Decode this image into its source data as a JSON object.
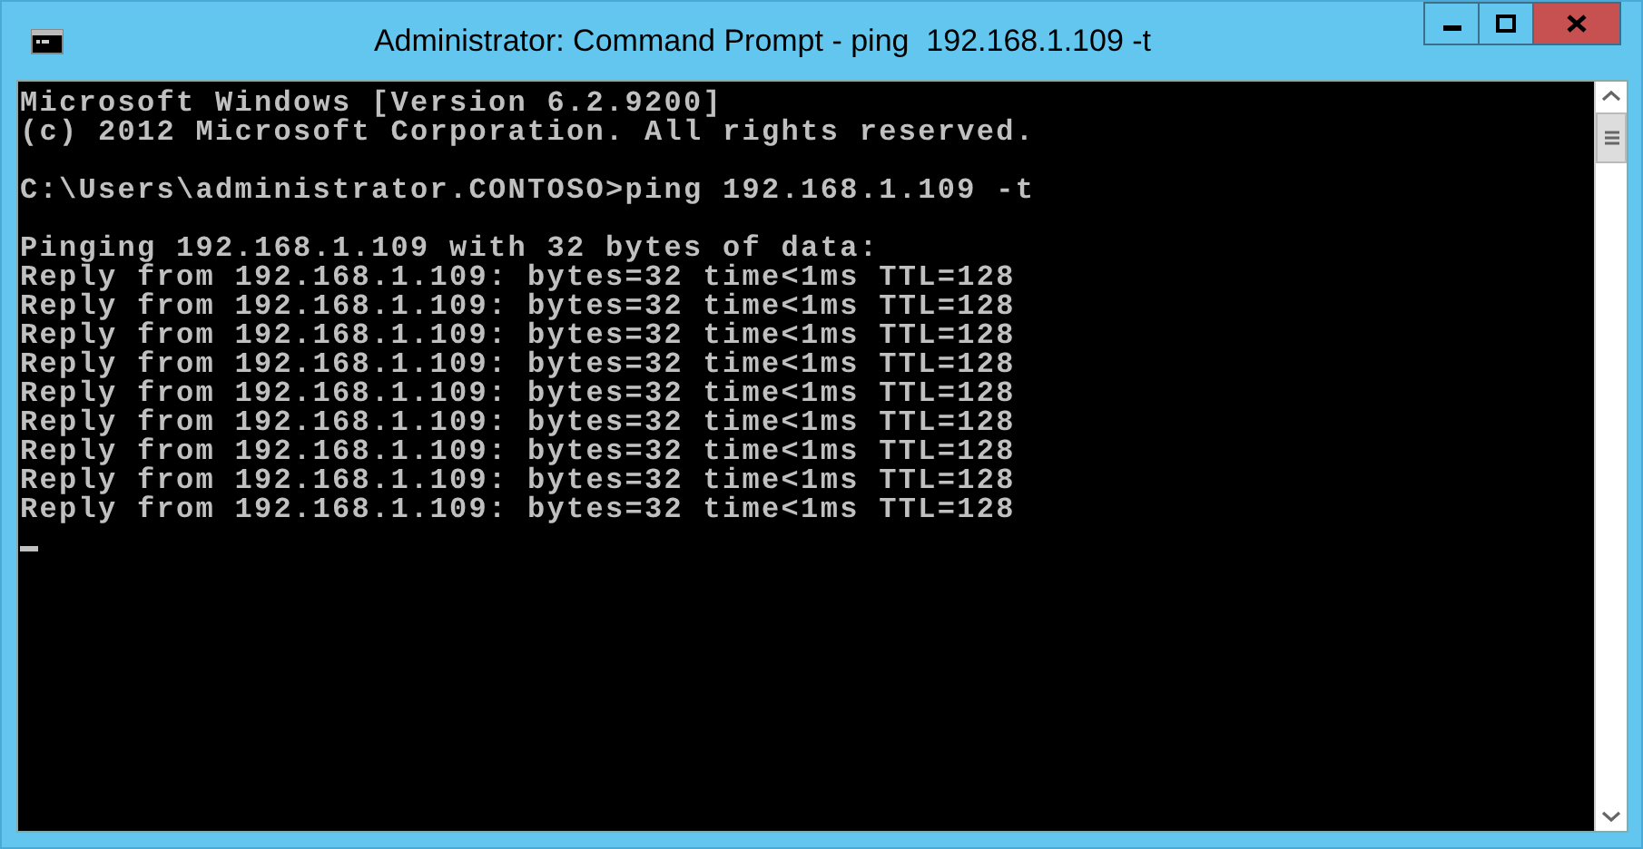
{
  "window": {
    "title": "Administrator: Command Prompt - ping  192.168.1.109 -t"
  },
  "console": {
    "blocks": [
      [
        "Microsoft Windows [Version 6.2.9200]",
        "(c) 2012 Microsoft Corporation. All rights reserved."
      ],
      [
        "C:\\Users\\administrator.CONTOSO>ping 192.168.1.109 -t"
      ],
      [
        "Pinging 192.168.1.109 with 32 bytes of data:",
        "Reply from 192.168.1.109: bytes=32 time<1ms TTL=128",
        "Reply from 192.168.1.109: bytes=32 time<1ms TTL=128",
        "Reply from 192.168.1.109: bytes=32 time<1ms TTL=128",
        "Reply from 192.168.1.109: bytes=32 time<1ms TTL=128",
        "Reply from 192.168.1.109: bytes=32 time<1ms TTL=128",
        "Reply from 192.168.1.109: bytes=32 time<1ms TTL=128",
        "Reply from 192.168.1.109: bytes=32 time<1ms TTL=128",
        "Reply from 192.168.1.109: bytes=32 time<1ms TTL=128",
        "Reply from 192.168.1.109: bytes=32 time<1ms TTL=128"
      ]
    ]
  }
}
